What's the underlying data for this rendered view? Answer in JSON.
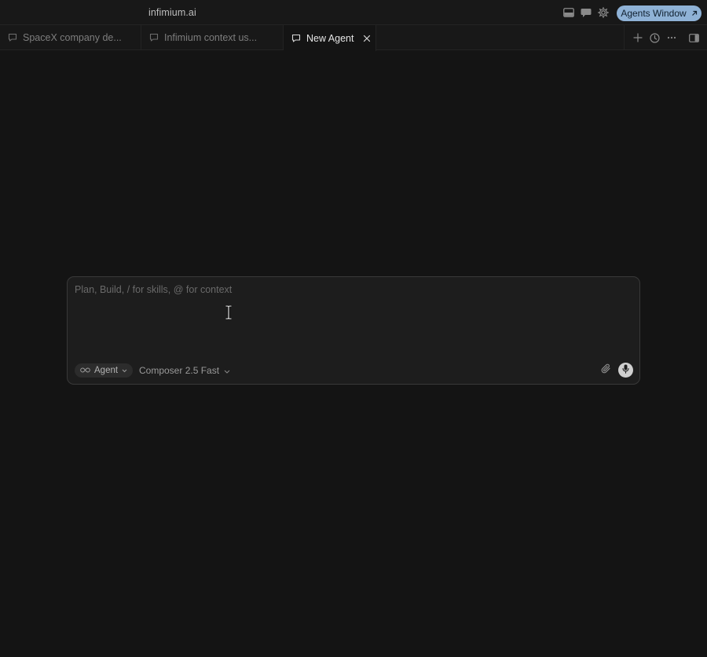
{
  "window": {
    "title": "infimium.ai",
    "agents_window_label": "Agents Window",
    "accent_color": "#8fb2d6"
  },
  "titlebar_icons": [
    "panel-bottom-icon",
    "chat-bubble-icon",
    "gear-icon"
  ],
  "tabs": [
    {
      "label": "SpaceX company de...",
      "icon": "chat-bubble-outline-icon",
      "active": false
    },
    {
      "label": "Infimium context us...",
      "icon": "chat-bubble-outline-icon",
      "active": false
    },
    {
      "label": "New Agent",
      "icon": "chat-bubble-outline-icon",
      "active": true
    }
  ],
  "tab_actions": [
    "plus-icon",
    "clock-icon",
    "more-horizontal-icon",
    "sidebar-right-icon"
  ],
  "composer": {
    "placeholder": "Plan, Build, / for skills, @ for context",
    "value": "",
    "mode_label": "Agent",
    "mode_icon": "infinity-icon",
    "model_label": "Composer 2.5 Fast"
  }
}
